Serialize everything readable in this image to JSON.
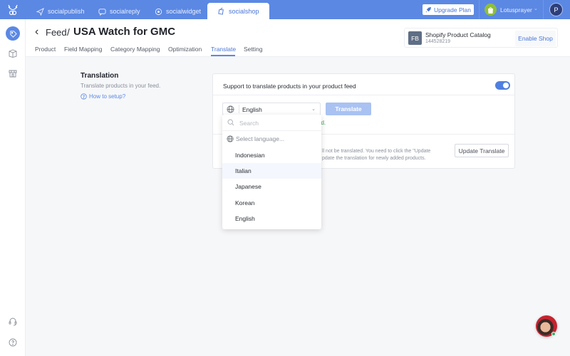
{
  "topbar": {
    "apps": [
      {
        "label": "socialpublish",
        "icon": "paper-plane-icon"
      },
      {
        "label": "socialreply",
        "icon": "chat-icon"
      },
      {
        "label": "socialwidget",
        "icon": "widget-icon"
      },
      {
        "label": "socialshop",
        "icon": "shopping-bag-icon",
        "active": true
      }
    ],
    "upgrade_label": "Upgrade Plan",
    "shop_name": "Lotusprayer",
    "user_initial": "P"
  },
  "header": {
    "breadcrumb_parent": "Feed",
    "separator": "/",
    "title": "USA Watch for GMC",
    "tabs": [
      {
        "label": "Product"
      },
      {
        "label": "Field Mapping"
      },
      {
        "label": "Category Mapping"
      },
      {
        "label": "Optimization"
      },
      {
        "label": "Translate",
        "active": true
      },
      {
        "label": "Setting"
      }
    ],
    "catalog": {
      "badge": "FB",
      "name": "Shopify Product Catalog",
      "id": "144528219",
      "action_label": "Enable Shop"
    }
  },
  "section": {
    "title": "Translation",
    "description": "Translate products in your feed.",
    "help_link": "How to setup?"
  },
  "card": {
    "support_label": "Support to translate products in your product feed",
    "toggle_on": true,
    "language_value": "English",
    "translate_label": "Translate",
    "success_text_visible": "ed.",
    "update_desc_line1": "ll not be translated. You need to click the \"Update",
    "update_desc_line2": "pdate the translation for newly added products.",
    "update_label": "Update Translate"
  },
  "dropdown": {
    "search_placeholder": "Search",
    "placeholder_option": "Select language...",
    "options": [
      "Indonesian",
      "Italian",
      "Japanese",
      "Korean",
      "English"
    ],
    "hovered": "Italian"
  },
  "colors": {
    "brand": "#5b88e3",
    "success": "#3ba55c"
  }
}
